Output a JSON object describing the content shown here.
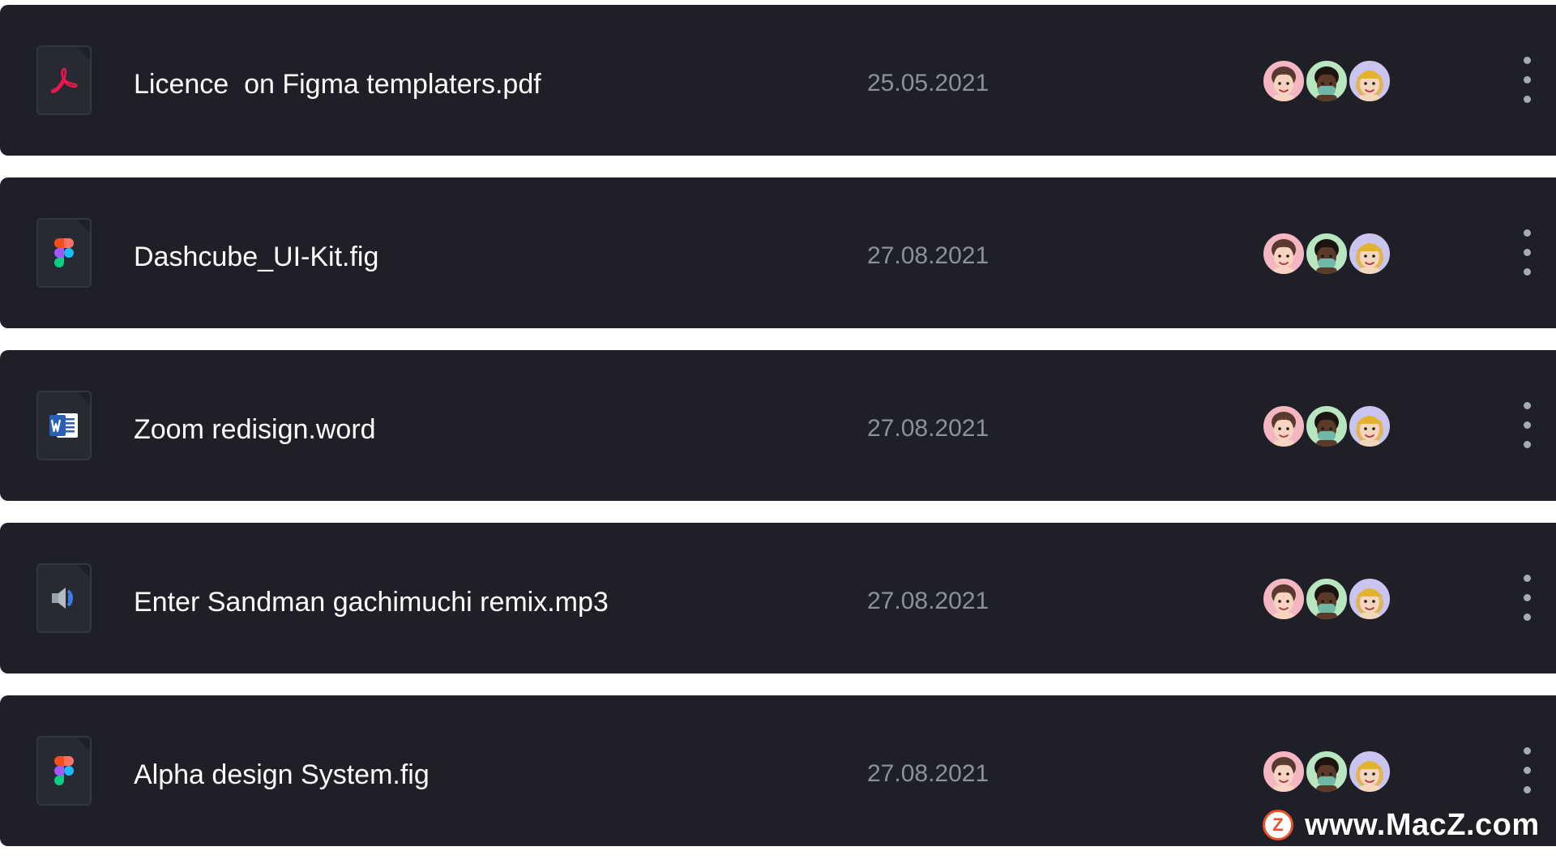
{
  "files": [
    {
      "name": "Licence  on Figma templaters.pdf",
      "date": "25.05.2021",
      "icon": "pdf-icon"
    },
    {
      "name": "Dashcube_UI-Kit.fig",
      "date": "27.08.2021",
      "icon": "figma-icon"
    },
    {
      "name": "Zoom redisign.word",
      "date": "27.08.2021",
      "icon": "word-icon"
    },
    {
      "name": "Enter Sandman gachimuchi remix.mp3",
      "date": "27.08.2021",
      "icon": "audio-icon"
    },
    {
      "name": "Alpha design System.fig",
      "date": "27.08.2021",
      "icon": "figma-icon"
    }
  ],
  "collaborators": [
    {
      "icon": "avatar-woman-icon",
      "bg": "#f4b7c2"
    },
    {
      "icon": "avatar-man-mask-icon",
      "bg": "#b8e6c0"
    },
    {
      "icon": "avatar-woman-hat-icon",
      "bg": "#c9c4f0"
    }
  ],
  "colors": {
    "row_background": "#1f2027",
    "filename": "#ffffff",
    "date": "#8c909c",
    "pdf_accent": "#e8174d",
    "word_accent": "#2b5eb5",
    "audio_accent": "#3b7de1"
  },
  "watermark": {
    "text": "www.MacZ.com",
    "logo_icon": "macz-logo-icon"
  }
}
